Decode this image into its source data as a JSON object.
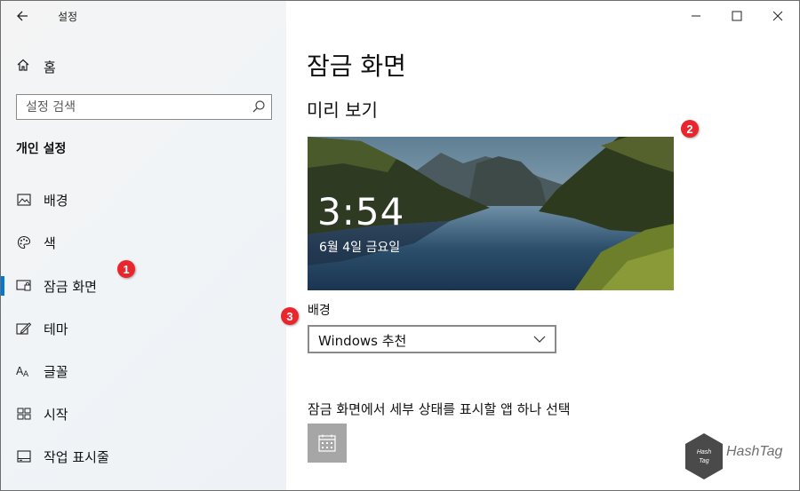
{
  "window": {
    "title": "설정"
  },
  "sidebar": {
    "home_label": "홈",
    "search_placeholder": "설정 검색",
    "section_title": "개인 설정",
    "items": [
      {
        "label": "배경",
        "icon": "image-icon",
        "selected": false
      },
      {
        "label": "색",
        "icon": "palette-icon",
        "selected": false
      },
      {
        "label": "잠금 화면",
        "icon": "lock-screen-icon",
        "selected": true
      },
      {
        "label": "테마",
        "icon": "theme-icon",
        "selected": false
      },
      {
        "label": "글꼴",
        "icon": "font-icon",
        "selected": false
      },
      {
        "label": "시작",
        "icon": "start-icon",
        "selected": false
      },
      {
        "label": "작업 표시줄",
        "icon": "taskbar-icon",
        "selected": false
      }
    ]
  },
  "main": {
    "page_title": "잠금 화면",
    "preview_title": "미리 보기",
    "preview": {
      "time": "3:54",
      "date": "6월 4일 금요일"
    },
    "background_label": "배경",
    "background_value": "Windows 추천",
    "apps_label": "잠금 화면에서 세부 상태를 표시할 앱 하나 선택",
    "app_tile_icon": "calendar-icon"
  },
  "annotations": [
    "1",
    "2",
    "3"
  ],
  "watermark": {
    "text": "HashTag",
    "logo_text": "Hash Tag"
  },
  "colors": {
    "accent": "#0078d7",
    "badge": "#e9262b",
    "tile": "#a6a6a6"
  }
}
